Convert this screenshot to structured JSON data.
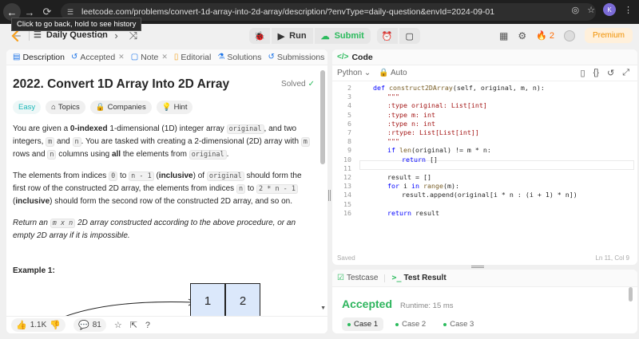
{
  "browser": {
    "url": "leetcode.com/problems/convert-1d-array-into-2d-array/description/?envType=daily-question&envId=2024-09-01",
    "tooltip": "Click to go back, hold to see history",
    "profile_initial": "K"
  },
  "appbar": {
    "problem_list_label": "Daily Question",
    "run_label": "Run",
    "submit_label": "Submit",
    "streak": "2",
    "premium_label": "Premium"
  },
  "left_tabs": [
    {
      "label": "Description"
    },
    {
      "label": "Accepted"
    },
    {
      "label": "Note"
    },
    {
      "label": "Editorial"
    },
    {
      "label": "Solutions"
    },
    {
      "label": "Submissions"
    }
  ],
  "problem": {
    "title": "2022. Convert 1D Array Into 2D Array",
    "status": "Solved",
    "difficulty": "Easy",
    "chips": [
      "Topics",
      "Companies",
      "Hint"
    ],
    "example_title": "Example 1:",
    "figure_top": [
      "1",
      "2"
    ]
  },
  "footer": {
    "likes": "1.1K",
    "comments": "81"
  },
  "code": {
    "header": "Code",
    "language": "Python",
    "mode": "Auto",
    "status": "Saved",
    "cursor": "Ln 11, Col 9",
    "lines": [
      {
        "n": "2",
        "indent": 0,
        "segments": [
          {
            "t": "def ",
            "c": "kw"
          },
          {
            "t": "construct2DArray",
            "c": "fn"
          },
          {
            "t": "(self, original, m, n):",
            "c": ""
          }
        ]
      },
      {
        "n": "3",
        "indent": 1,
        "segments": [
          {
            "t": "\"\"\"",
            "c": "cm"
          }
        ]
      },
      {
        "n": "4",
        "indent": 1,
        "segments": [
          {
            "t": ":type original: List[int]",
            "c": "cm"
          }
        ]
      },
      {
        "n": "5",
        "indent": 1,
        "segments": [
          {
            "t": ":type m: int",
            "c": "cm"
          }
        ]
      },
      {
        "n": "6",
        "indent": 1,
        "segments": [
          {
            "t": ":type n: int",
            "c": "cm"
          }
        ]
      },
      {
        "n": "7",
        "indent": 1,
        "segments": [
          {
            "t": ":rtype: List[List[int]]",
            "c": "cm"
          }
        ]
      },
      {
        "n": "8",
        "indent": 1,
        "segments": [
          {
            "t": "\"\"\"",
            "c": "cm"
          }
        ]
      },
      {
        "n": "9",
        "indent": 1,
        "segments": [
          {
            "t": "if ",
            "c": "kw"
          },
          {
            "t": "len",
            "c": "fn"
          },
          {
            "t": "(original) != m * n:",
            "c": ""
          }
        ]
      },
      {
        "n": "10",
        "indent": 2,
        "segments": [
          {
            "t": "return ",
            "c": "kw"
          },
          {
            "t": "[]",
            "c": ""
          }
        ]
      },
      {
        "n": "11",
        "indent": 0,
        "segments": []
      },
      {
        "n": "12",
        "indent": 1,
        "segments": [
          {
            "t": "result = []",
            "c": ""
          }
        ]
      },
      {
        "n": "13",
        "indent": 1,
        "segments": [
          {
            "t": "for ",
            "c": "kw"
          },
          {
            "t": "i ",
            "c": ""
          },
          {
            "t": "in ",
            "c": "kw"
          },
          {
            "t": "range",
            "c": "fn"
          },
          {
            "t": "(m):",
            "c": ""
          }
        ]
      },
      {
        "n": "14",
        "indent": 2,
        "segments": [
          {
            "t": "result.append(original[i * n : (i + 1) * n])",
            "c": ""
          }
        ]
      },
      {
        "n": "15",
        "indent": 0,
        "segments": []
      },
      {
        "n": "16",
        "indent": 1,
        "segments": [
          {
            "t": "return ",
            "c": "kw"
          },
          {
            "t": "result",
            "c": ""
          }
        ]
      }
    ]
  },
  "test": {
    "tab_testcase": "Testcase",
    "tab_result": "Test Result",
    "verdict": "Accepted",
    "runtime": "Runtime: 15 ms",
    "cases": [
      "Case 1",
      "Case 2",
      "Case 3"
    ]
  }
}
